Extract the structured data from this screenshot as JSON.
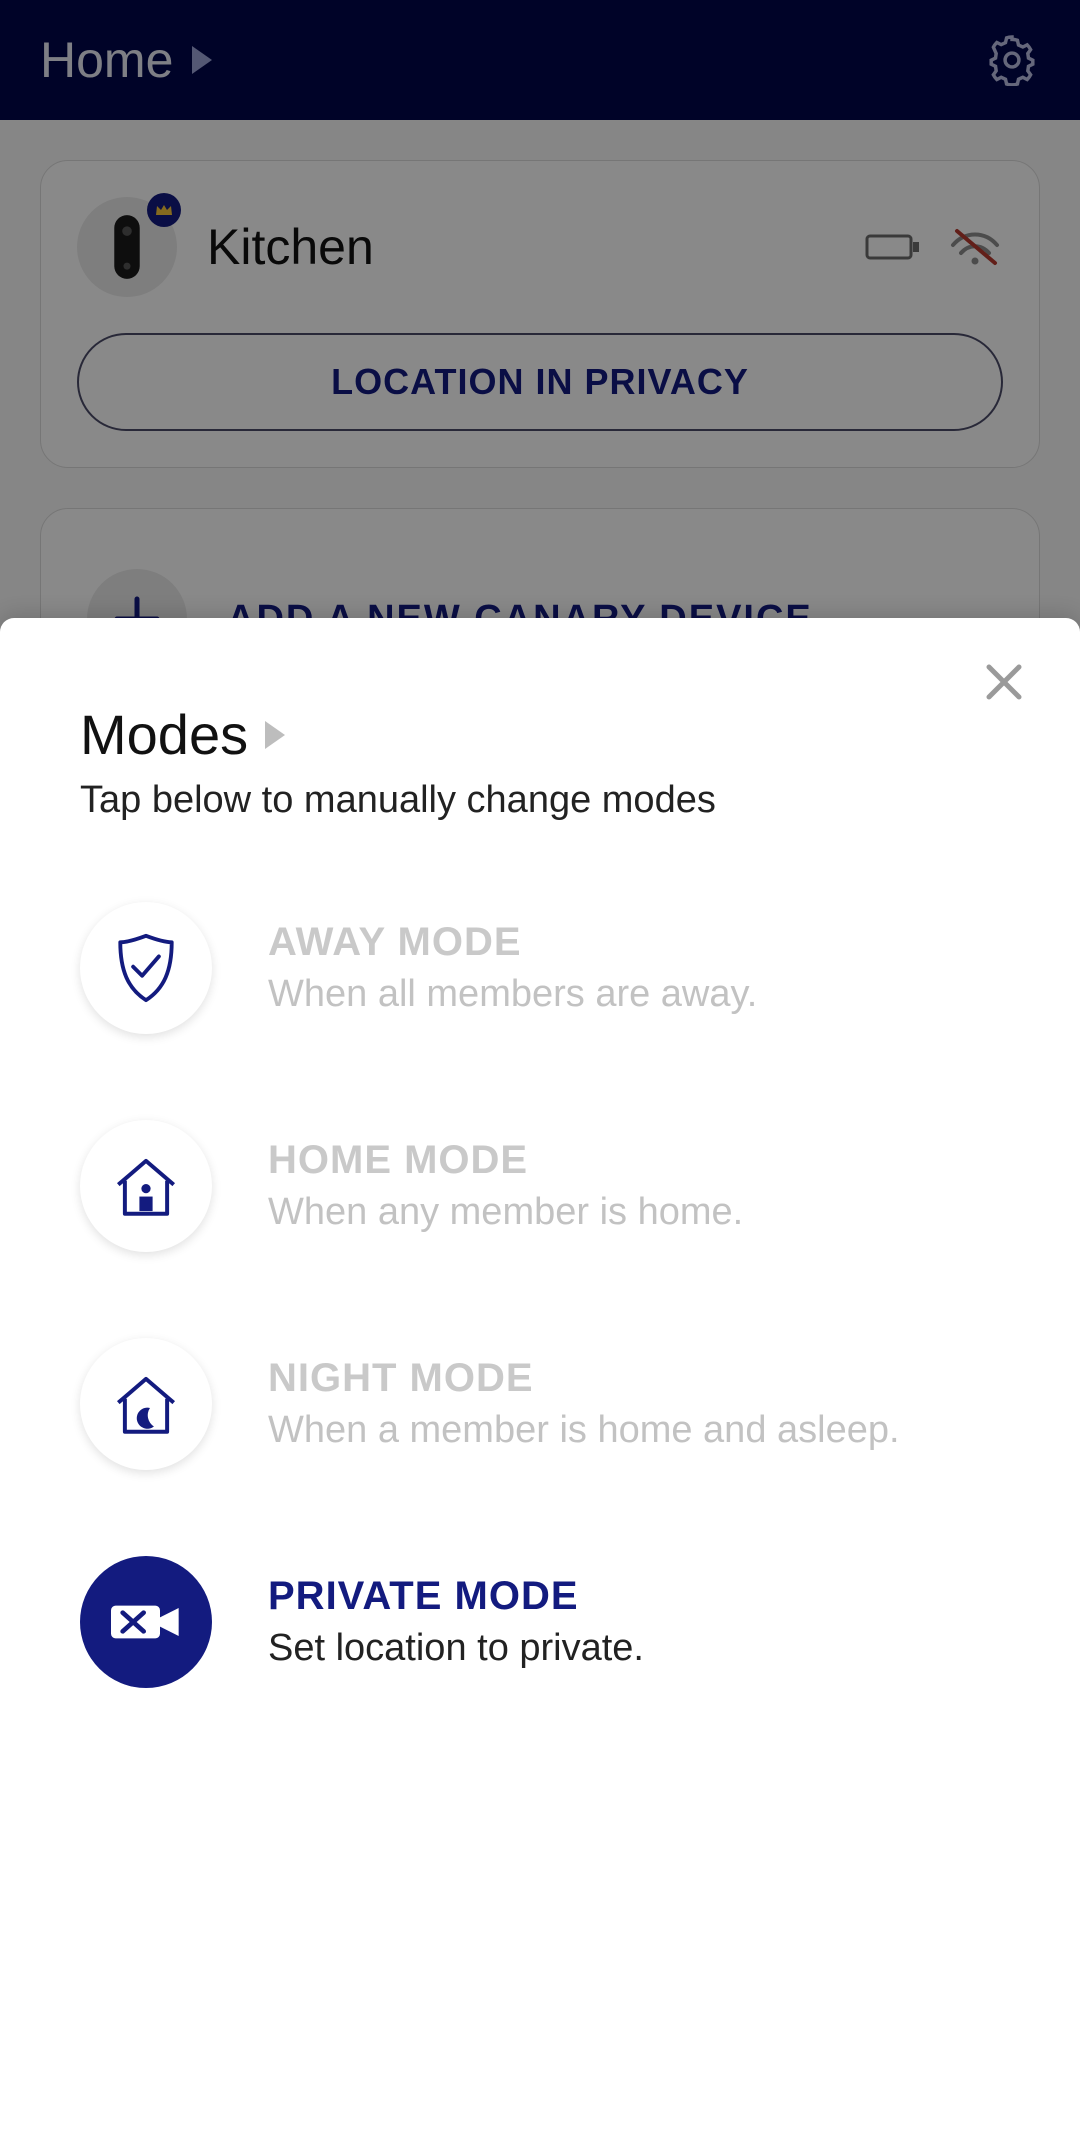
{
  "colors": {
    "brand": "#131b7f",
    "headerBg": "#01064a",
    "muted": "#c9c9c9"
  },
  "header": {
    "title": "Home"
  },
  "device": {
    "name": "Kitchen",
    "status_button": "LOCATION IN PRIVACY",
    "battery_icon": "battery-empty-icon",
    "wifi_icon": "wifi-off-icon",
    "crown": true
  },
  "add_device": {
    "label": "ADD A NEW CANARY DEVICE"
  },
  "sheet": {
    "title": "Modes",
    "subtitle": "Tap below to manually change modes",
    "modes": [
      {
        "id": "away",
        "icon": "shield-check-icon",
        "title": "AWAY MODE",
        "desc": "When all members are away.",
        "active": false
      },
      {
        "id": "home",
        "icon": "house-person-icon",
        "title": "HOME MODE",
        "desc": "When any member is home.",
        "active": false
      },
      {
        "id": "night",
        "icon": "house-moon-icon",
        "title": "NIGHT MODE",
        "desc": "When a member is home and asleep.",
        "active": false
      },
      {
        "id": "private",
        "icon": "camera-off-icon",
        "title": "PRIVATE MODE",
        "desc": "Set location to private.",
        "active": true
      }
    ]
  }
}
